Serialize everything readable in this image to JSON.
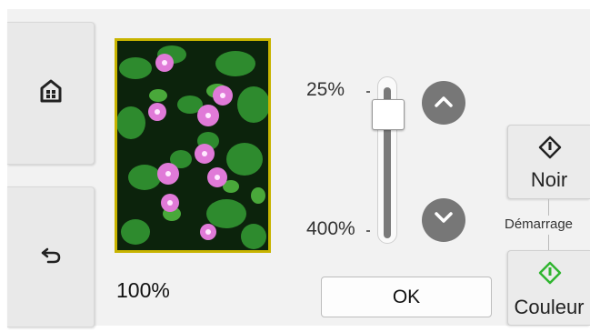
{
  "zoom": {
    "current": "100%",
    "min_label": "25%",
    "max_label": "400%",
    "level_fraction": 0.1
  },
  "buttons": {
    "ok_label": "OK",
    "black_label": "Noir",
    "color_label": "Couleur",
    "start_caption": "Démarrage"
  },
  "icons": {
    "home": "home-icon",
    "back": "back-arrow-icon",
    "up": "chevron-up-icon",
    "down": "chevron-down-icon",
    "start": "start-diamond-icon"
  },
  "colors": {
    "preview_border": "#c8b400",
    "start_color_icon": "#2fb52f",
    "round_button": "#777777"
  }
}
